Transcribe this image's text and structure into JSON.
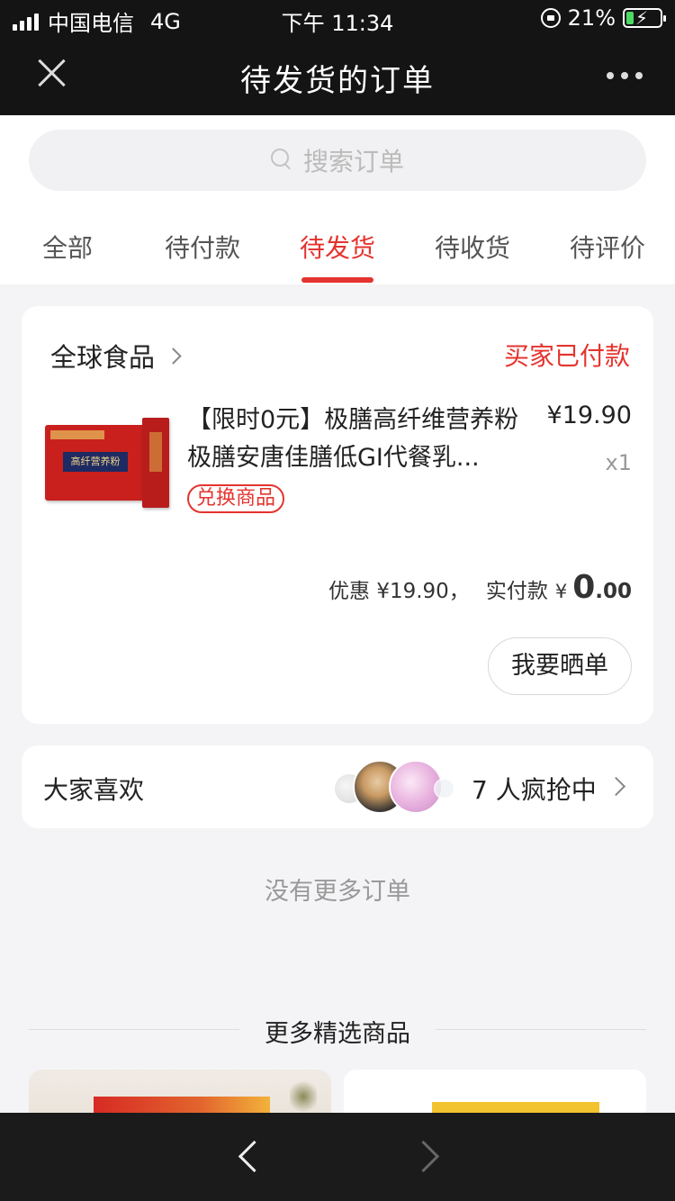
{
  "status_bar": {
    "carrier": "中国电信",
    "network": "4G",
    "time": "下午 11:34",
    "battery": "21%",
    "battery_level": 0.21
  },
  "nav": {
    "title": "待发货的订单",
    "close_icon": "close-icon",
    "more_icon": "more-dots-icon"
  },
  "search": {
    "placeholder": "搜索订单",
    "icon": "search-icon"
  },
  "tabs": [
    {
      "label": "全部",
      "active": false
    },
    {
      "label": "待付款",
      "active": false
    },
    {
      "label": "待发货",
      "active": true
    },
    {
      "label": "待收货",
      "active": false
    },
    {
      "label": "待评价",
      "active": false
    }
  ],
  "order": {
    "shop_name": "全球食品",
    "status": "买家已付款",
    "product": {
      "title": "【限时0元】极膳高纤维营养粉极膳安唐佳膳低GI代餐乳...",
      "price": "¥19.90",
      "quantity": "x1",
      "tag": "兑换商品"
    },
    "summary": {
      "discount_label": "优惠 ¥19.90，",
      "paid_label": "实付款",
      "currency": "¥",
      "paid_int": "0",
      "paid_dec": ".00"
    },
    "share_button": "我要晒单"
  },
  "likes": {
    "title": "大家喜欢",
    "count_text": "7 人疯抢中"
  },
  "no_more": "没有更多订单",
  "recommend": {
    "title": "更多精选商品"
  },
  "colors": {
    "accent": "#e5332e",
    "nav_bg": "#141414",
    "page_bg": "#f4f4f6"
  }
}
